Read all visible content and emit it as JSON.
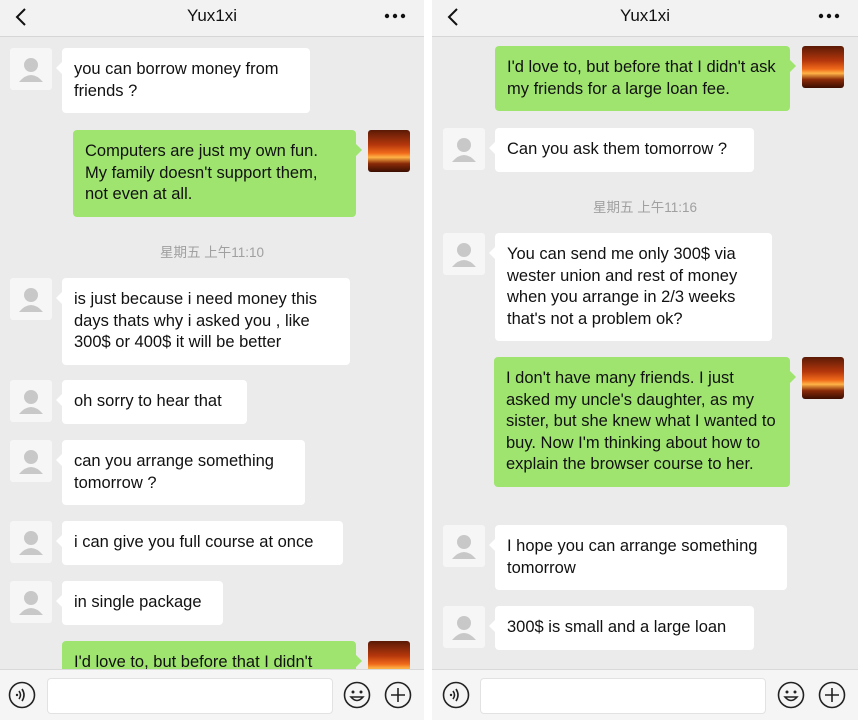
{
  "left": {
    "title": "Yux1xi",
    "timestamp": "星期五 上午11:10",
    "messages": [
      {
        "from": "them",
        "text": "you can borrow money from friends ?"
      },
      {
        "from": "me",
        "text": "Computers are just my own fun. My family doesn't support them, not even at all."
      },
      {
        "from": "them",
        "text": "is just because i need money this days thats why i asked you , like 300$ or 400$ it will be better"
      },
      {
        "from": "them",
        "text": "oh sorry to hear that"
      },
      {
        "from": "them",
        "text": "can you arrange something tomorrow ?"
      },
      {
        "from": "them",
        "text": "i can give you full course at once"
      },
      {
        "from": "them",
        "text": "in single package"
      },
      {
        "from": "me",
        "text": "I'd love to, but before that I didn't"
      }
    ]
  },
  "right": {
    "title": "Yux1xi",
    "timestamp": "星期五 上午11:16",
    "messages": [
      {
        "from": "me",
        "text": "I'd love to, but before that I didn't ask my friends for a large loan fee."
      },
      {
        "from": "them",
        "text": "Can you ask them tomorrow ?"
      },
      {
        "from": "them",
        "text": "You can send me only 300$ via wester union and rest of money when you arrange in 2/3 weeks that's not a problem ok?"
      },
      {
        "from": "me",
        "text": "I don't have many friends. I just asked my uncle's daughter, as my sister, but she knew what I wanted to buy. Now I'm thinking about how to explain the browser course to her."
      },
      {
        "from": "them",
        "text": "I hope you can arrange something tomorrow"
      },
      {
        "from": "them",
        "text": "300$ is small and a large loan"
      }
    ]
  },
  "icons": [
    "back-icon",
    "more-icon",
    "default-avatar-icon",
    "voice-icon",
    "emoji-icon",
    "plus-icon"
  ],
  "colors": {
    "outgoing_bubble": "#9fe46f",
    "incoming_bubble": "#ffffff",
    "chat_background": "#ebebeb"
  }
}
